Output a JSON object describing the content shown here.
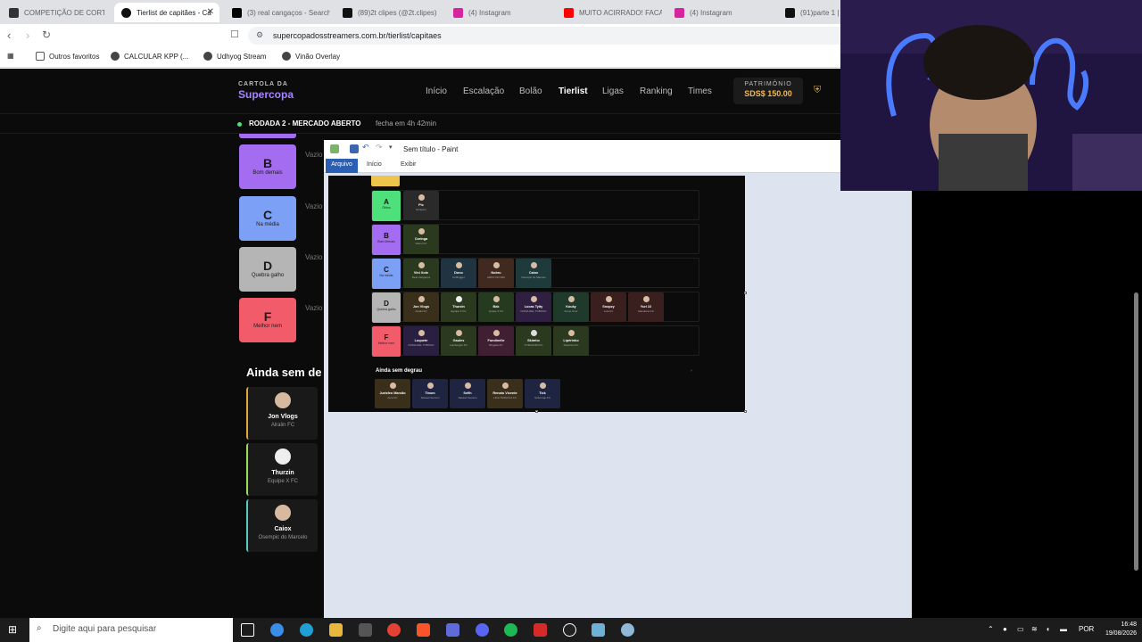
{
  "browser": {
    "tabs": [
      {
        "title": "COMPETIÇÃO DE CORTES",
        "active": false,
        "color": "#333333"
      },
      {
        "title": "Tierlist de capitães - Ca",
        "active": true,
        "color": "#111111"
      },
      {
        "title": "(3) real cangaços - Search",
        "active": false,
        "color": "#000000"
      },
      {
        "title": "(89)2t clipes (@2t.clipes)",
        "active": false,
        "color": "#111111"
      },
      {
        "title": "(4) Instagram",
        "active": false,
        "color": "#d6249f"
      },
      {
        "title": "MUITO ACIRRADO! FACA",
        "active": false,
        "color": "#ff0000"
      },
      {
        "title": "(4) Instagram",
        "active": false,
        "color": "#d6249f"
      },
      {
        "title": "(91)parte 1 | y",
        "active": false,
        "color": "#111111"
      }
    ],
    "url": "supercopadosstreamers.com.br/tierlist/capitaes",
    "bookmarks": [
      "Outros favoritos",
      "CALCULAR KPP (...",
      "Udhyog Stream",
      "Vinão Overlay"
    ]
  },
  "site": {
    "logo_small": "CARTOLA DA",
    "logo_big": "Supercopa",
    "nav": [
      "Início",
      "Escalação",
      "Bolão",
      "Tierlist",
      "Ligas",
      "Ranking",
      "Times"
    ],
    "nav_active": "Tierlist",
    "patrimonio_label": "PATRIMÔNIO",
    "patrimonio_value": "SDS$ 150.00",
    "round_title": "RODADA 2 - MERCADO ABERTO",
    "round_timer": "fecha em 4h  42min",
    "tiers": [
      {
        "letter": "B",
        "label": "Bom demais",
        "color": "#a46cf0",
        "empty": "Vazio"
      },
      {
        "letter": "C",
        "label": "Na média",
        "color": "#7ca0f5",
        "empty": "Vazio"
      },
      {
        "letter": "D",
        "label": "Quebra galho",
        "color": "#b5b5b5",
        "empty": "Vazio"
      },
      {
        "letter": "F",
        "label": "Melhor nem",
        "color": "#f25c6a",
        "empty": "Vazio"
      }
    ],
    "unranked_title": "Ainda sem degrau",
    "unranked_visible": "Ainda sem de",
    "players": [
      {
        "name": "Jon Vlogs",
        "club": "Alralin FC",
        "color": "#e0a63a"
      },
      {
        "name": "Thurzin",
        "club": "Equipe X FC",
        "color": "#9bdc55"
      },
      {
        "name": "Caiox",
        "club": "Osempic do Marcelo",
        "color": "#56c9c0"
      }
    ]
  },
  "paint": {
    "title": "Sem título - Paint",
    "ribbon": [
      "Arquivo",
      "Início",
      "Exibir"
    ],
    "image_rows": [
      {
        "letter": "A",
        "label": "Ótimo",
        "color": "#4ee07a",
        "cards": [
          {
            "name": "Pic",
            "club": "Scrapinc"
          }
        ]
      },
      {
        "letter": "B",
        "label": "Bom demais",
        "color": "#a46cf0",
        "cards": [
          {
            "name": "Coringa",
            "club": "Vasco FC"
          }
        ]
      },
      {
        "letter": "C",
        "label": "Na média",
        "color": "#7ca0f5",
        "cards": [
          {
            "name": "Vini Xote",
            "club": "Real Cangaços"
          },
          {
            "name": "Dono",
            "club": "Uniflogger"
          },
          {
            "name": "Nobru",
            "club": "ARKO DO RIO"
          },
          {
            "name": "Caiox",
            "club": "Osempic do Marcelo"
          }
        ]
      },
      {
        "letter": "D",
        "label": "Quebra galho",
        "color": "#b5b5b5",
        "cards": [
          {
            "name": "Jon Vlogs",
            "club": "Alralin FC"
          },
          {
            "name": "Thurzin",
            "club": "Equipe X FC"
          },
          {
            "name": "Bak",
            "club": "Quase X FC"
          },
          {
            "name": "Lucas Tylty",
            "club": "DOMA DEL TOBOSO"
          },
          {
            "name": "Kouky",
            "club": "Fome Cruz"
          },
          {
            "name": "Snopzy",
            "club": "Lula FC"
          },
          {
            "name": "Yuri 22",
            "club": "Mandioca FC"
          }
        ]
      },
      {
        "letter": "F",
        "label": "Melhor nem",
        "color": "#f25c6a",
        "cards": [
          {
            "name": "Luquete",
            "club": "DOMA DEL TOBOSO"
          },
          {
            "name": "Gaules",
            "club": "Lamborgini FC"
          },
          {
            "name": "Fundinelle",
            "club": "Brigada FC"
          },
          {
            "name": "Skimho",
            "club": "TORCHORI FC"
          },
          {
            "name": "Lipérinho",
            "club": "Desertos FC"
          }
        ]
      }
    ],
    "image_unranked_title": "Ainda sem degrau",
    "image_unranked": [
      {
        "name": "Jurisfeo Marcão",
        "club": "Aura FC"
      },
      {
        "name": "Tinom",
        "club": "Sassari Sezemi"
      },
      {
        "name": "Sefih",
        "club": "Sassari Sezemi"
      },
      {
        "name": "Renato Vicente",
        "club": "LIGA TRAVOLA FC"
      },
      {
        "name": "Tick",
        "club": "Suborraje FC"
      }
    ]
  },
  "taskbar": {
    "search_placeholder": "Digite aqui para pesquisar",
    "lang": "POR",
    "time": "16:48",
    "date": "19/08/2026"
  }
}
